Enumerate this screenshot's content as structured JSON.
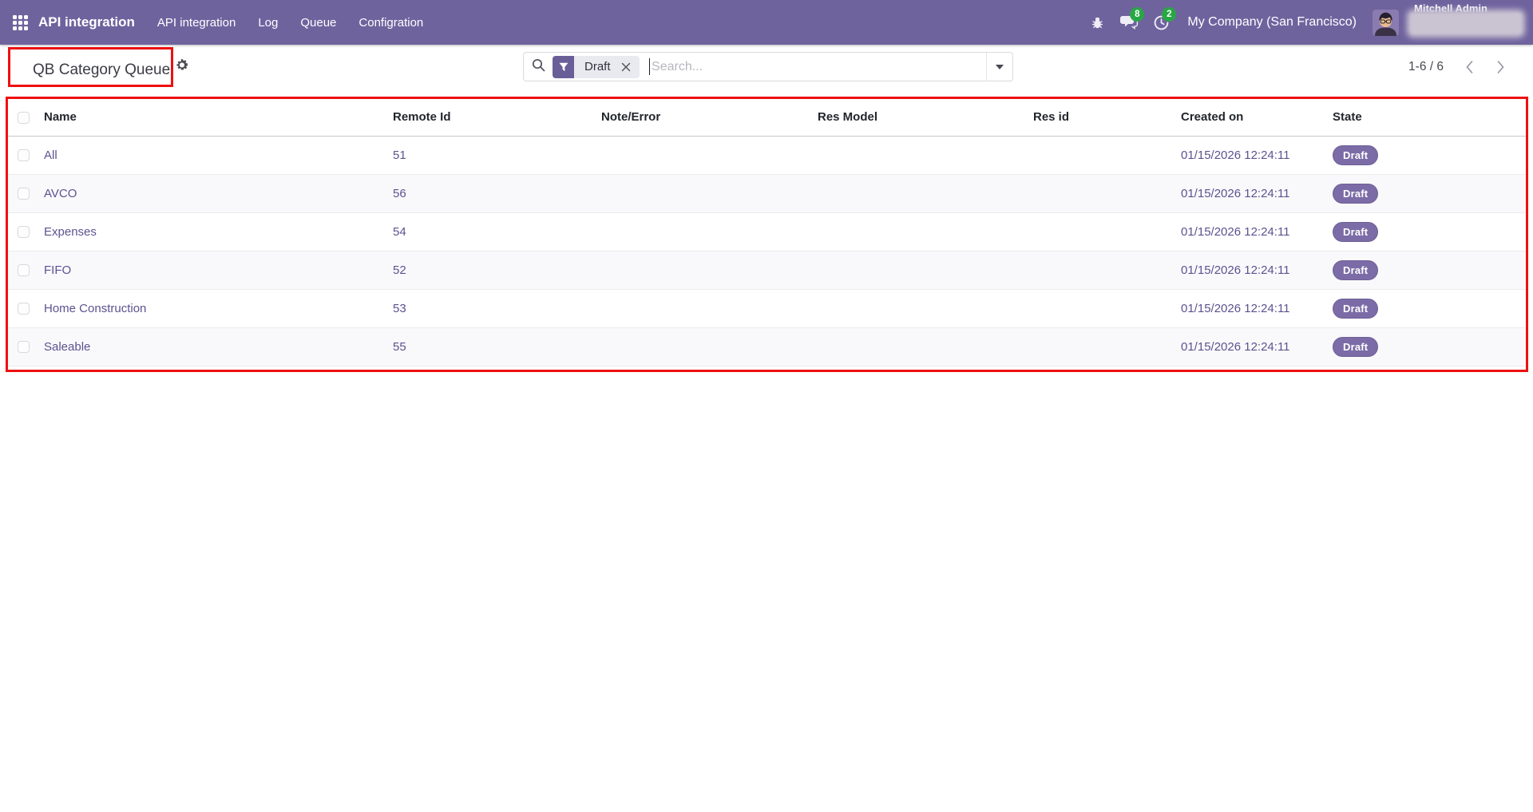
{
  "topbar": {
    "app_name": "API integration",
    "menu_items": [
      {
        "label": "API integration"
      },
      {
        "label": "Log"
      },
      {
        "label": "Queue"
      },
      {
        "label": "Configration"
      }
    ],
    "messages_badge": "8",
    "activities_badge": "2",
    "company": "My Company (San Francisco)",
    "user_name": "Mitchell Admin"
  },
  "control_panel": {
    "title": "QB Category Queue",
    "search": {
      "facet": "Draft",
      "placeholder": "Search..."
    },
    "pager": "1-6 / 6"
  },
  "table": {
    "columns": [
      "Name",
      "Remote Id",
      "Note/Error",
      "Res Model",
      "Res id",
      "Created on",
      "State"
    ],
    "rows": [
      {
        "name": "All",
        "remote_id": "51",
        "note_error": "",
        "res_model": "",
        "res_id": "",
        "created_on": "01/15/2026 12:24:11",
        "state": "Draft"
      },
      {
        "name": "AVCO",
        "remote_id": "56",
        "note_error": "",
        "res_model": "",
        "res_id": "",
        "created_on": "01/15/2026 12:24:11",
        "state": "Draft"
      },
      {
        "name": "Expenses",
        "remote_id": "54",
        "note_error": "",
        "res_model": "",
        "res_id": "",
        "created_on": "01/15/2026 12:24:11",
        "state": "Draft"
      },
      {
        "name": "FIFO",
        "remote_id": "52",
        "note_error": "",
        "res_model": "",
        "res_id": "",
        "created_on": "01/15/2026 12:24:11",
        "state": "Draft"
      },
      {
        "name": "Home Construction",
        "remote_id": "53",
        "note_error": "",
        "res_model": "",
        "res_id": "",
        "created_on": "01/15/2026 12:24:11",
        "state": "Draft"
      },
      {
        "name": "Saleable",
        "remote_id": "55",
        "note_error": "",
        "res_model": "",
        "res_id": "",
        "created_on": "01/15/2026 12:24:11",
        "state": "Draft"
      }
    ]
  },
  "colors": {
    "topbar_purple": "#6F639E",
    "badge_purple": "#7B6BA6",
    "link_purple": "#5C5290",
    "notification_green": "#28A745",
    "annotation_red": "#EE1010"
  }
}
